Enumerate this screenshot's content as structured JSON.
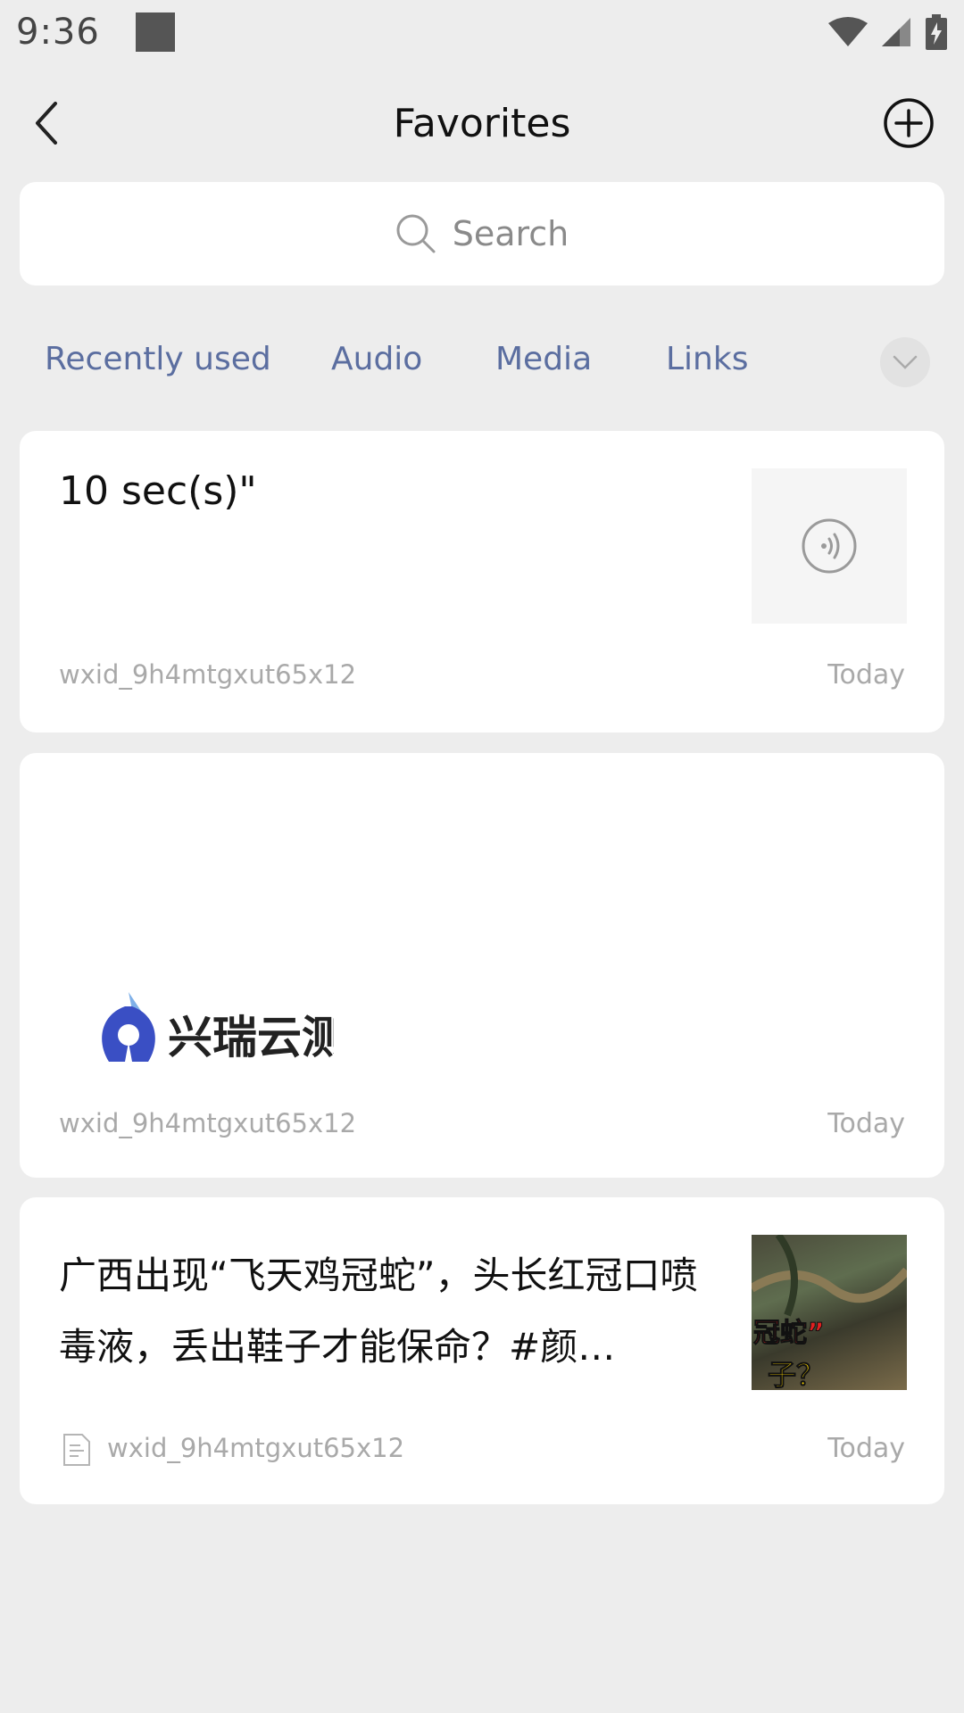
{
  "status_bar": {
    "time": "9:36"
  },
  "header": {
    "title": "Favorites"
  },
  "search": {
    "placeholder": "Search"
  },
  "tabs": [
    {
      "label": "Recently used"
    },
    {
      "label": "Audio"
    },
    {
      "label": "Media"
    },
    {
      "label": "Links"
    }
  ],
  "items": [
    {
      "type": "audio",
      "text": "10 sec(s)\"",
      "source": "wxid_9h4mtgxut65x12",
      "date": "Today"
    },
    {
      "type": "image",
      "logo_text": "兴瑞云测",
      "source": "wxid_9h4mtgxut65x12",
      "date": "Today"
    },
    {
      "type": "link",
      "text": "广西出现“飞天鸡冠蛇”，头长红冠口喷毒液，丢出鞋子才能保命？#颜…",
      "thumb_caption_1": "冠蛇”",
      "thumb_caption_2": "子？",
      "source": "wxid_9h4mtgxut65x12",
      "date": "Today"
    }
  ],
  "colors": {
    "background": "#ededed",
    "card": "#ffffff",
    "tab_text": "#5b6ea0",
    "meta_text": "#a9a9a9"
  }
}
